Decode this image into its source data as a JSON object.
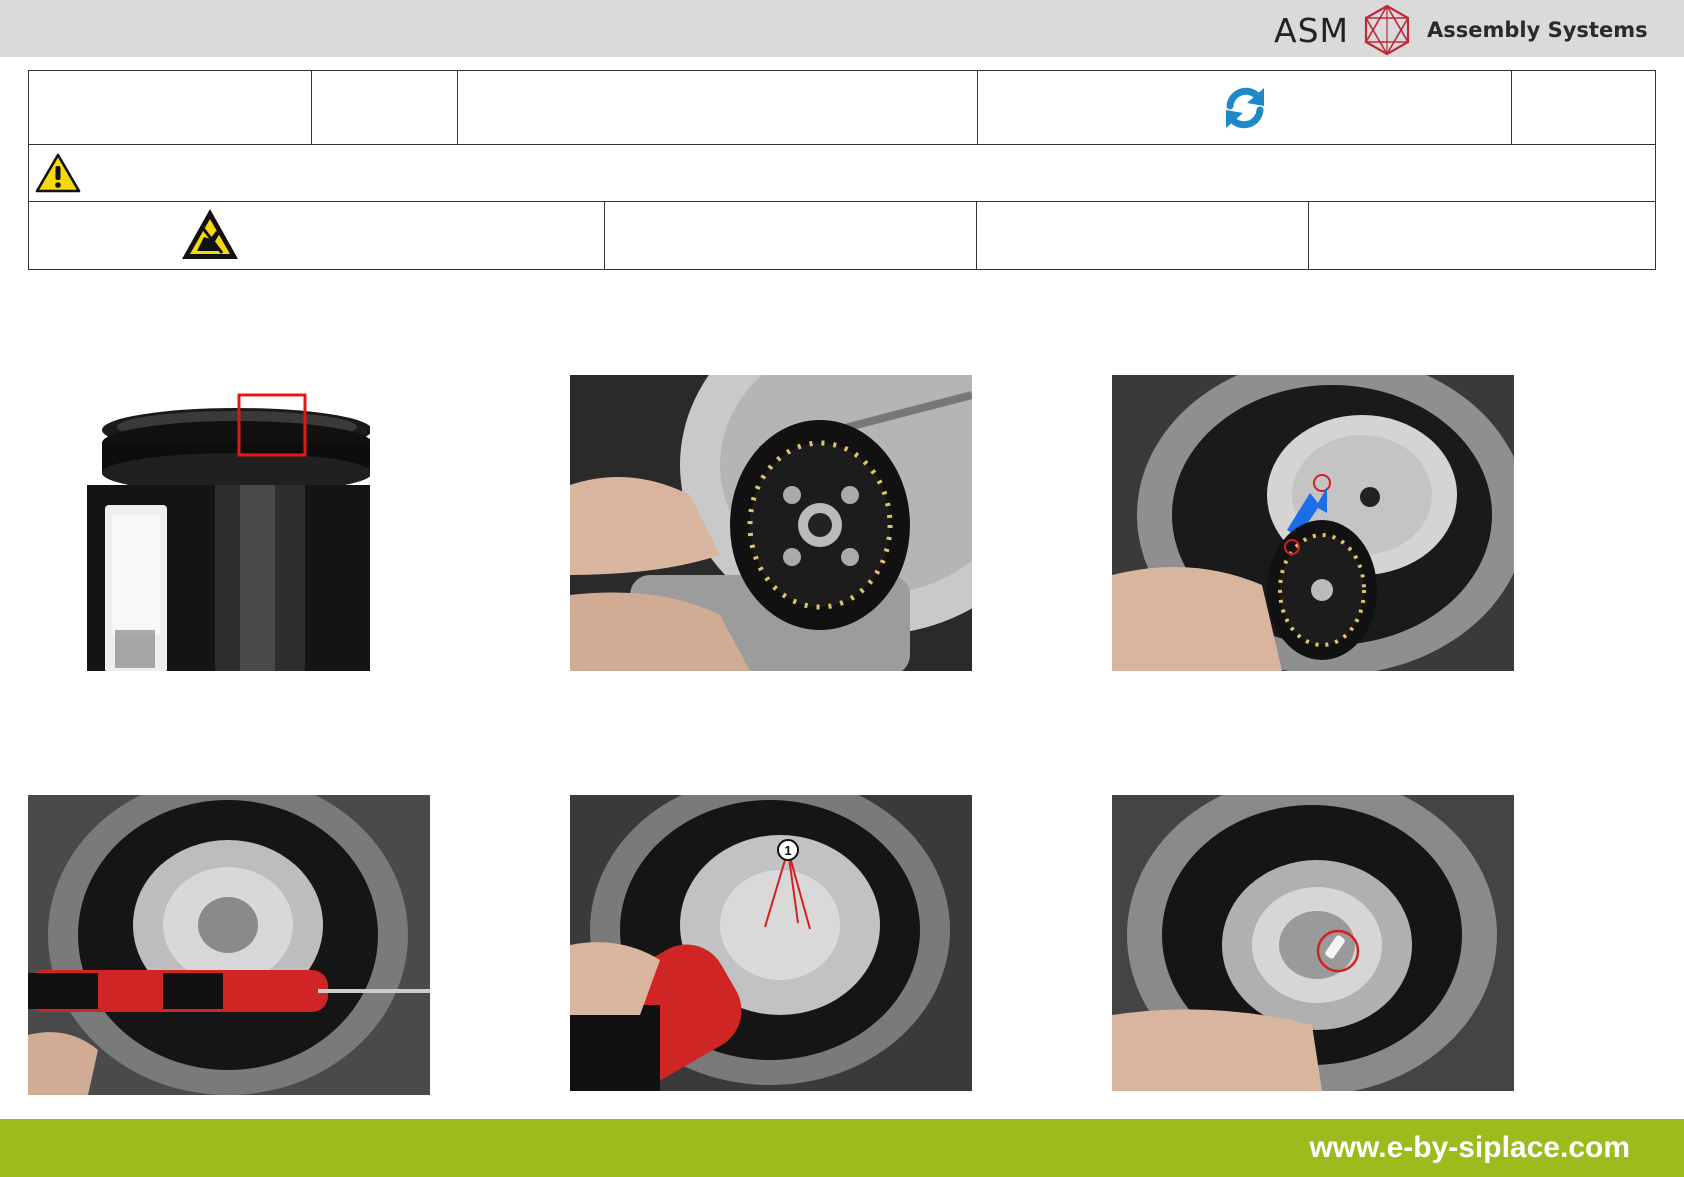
{
  "header": {
    "brand_name": "ASM",
    "brand_subtitle": "Assembly Systems"
  },
  "icons": {
    "refresh": "refresh-icon",
    "warning": "warning-triangle-icon",
    "esd": "esd-hand-icon"
  },
  "colors": {
    "topbar": "#dadada",
    "footer": "#9dbb1c",
    "refresh_blue": "#1e88c8",
    "marker_red": "#d32020",
    "arrow_blue": "#1a6ee8"
  },
  "photos": [
    {
      "id": "step-1",
      "subject": "pipette holder with marked notch"
    },
    {
      "id": "step-2",
      "subject": "removing encoder disc"
    },
    {
      "id": "step-3",
      "subject": "aligning disc with marked holes"
    },
    {
      "id": "step-4",
      "subject": "torque screwdriver on star"
    },
    {
      "id": "step-5",
      "subject": "screws marked",
      "callout": "1"
    },
    {
      "id": "step-6",
      "subject": "pin marked on star"
    }
  ],
  "footer": {
    "url": "www.e-by-siplace.com"
  }
}
